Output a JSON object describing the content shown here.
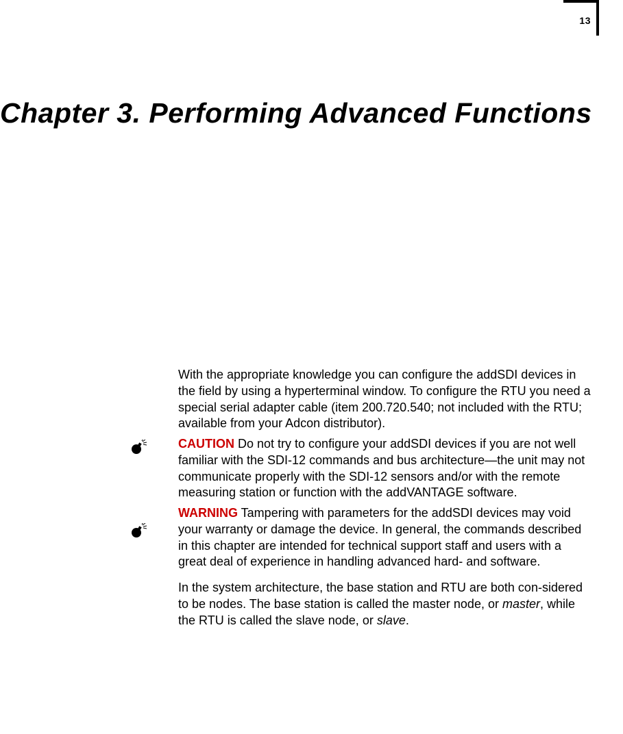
{
  "page_number": "13",
  "chapter_title": "Chapter 3. Performing Advanced Functions",
  "intro_para": "With the appropriate knowledge you can configure the addSDI devices in the field by using a hyperterminal window. To configure the RTU you need a special serial adapter cable (item 200.720.540; not included with the RTU; available from your Adcon distributor).",
  "caution": {
    "label": "CAUTION",
    "text": " Do not try to configure your addSDI devices if you are not well familiar with the SDI-12 commands and bus architecture—the unit may not communicate properly with the SDI-12 sensors and/or with the remote measuring station or function with the addVANTAGE software."
  },
  "warning": {
    "label": "WARNING",
    "text": "  Tampering with parameters for the addSDI devices may void your warranty or damage the device. In general, the commands described in this chapter are intended for technical support staff and users with a great deal of experience in handling advanced hard- and software."
  },
  "arch_para_pre": "In the system architecture, the base station and RTU are both con-sidered to be nodes. The base station is called the master node, or ",
  "arch_para_master": "master",
  "arch_para_mid": ", while the RTU is called the slave node, or ",
  "arch_para_slave": "slave",
  "arch_para_post": "."
}
